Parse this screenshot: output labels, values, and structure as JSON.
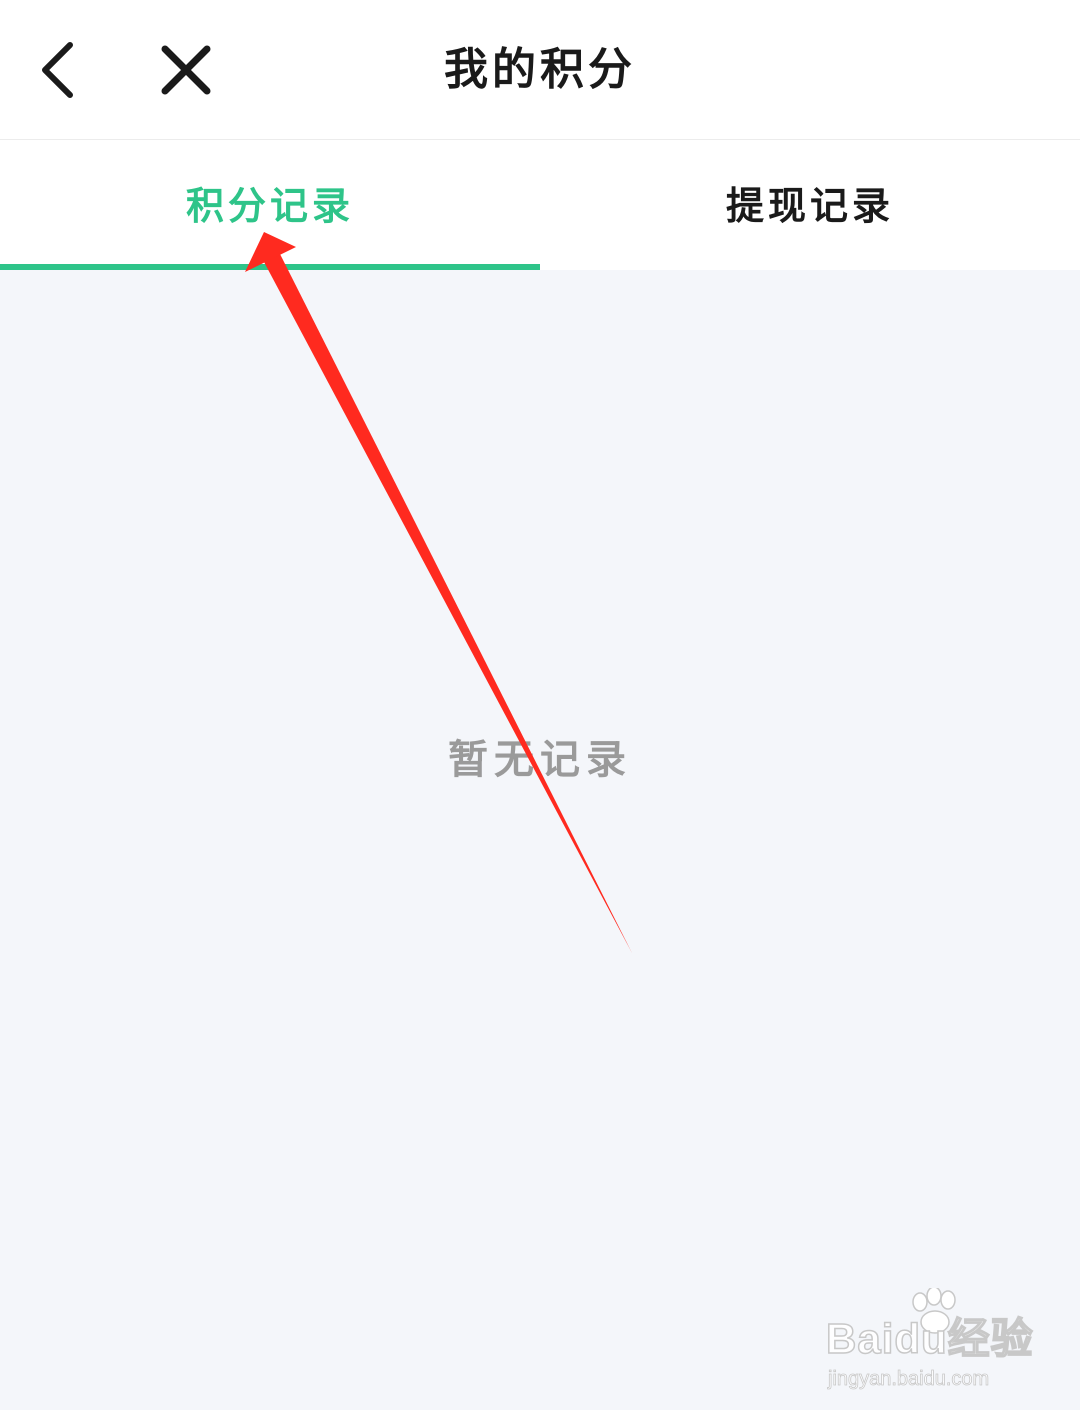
{
  "header": {
    "back_icon": "chevron-left-icon",
    "close_icon": "close-icon",
    "title": "我的积分"
  },
  "tabs": [
    {
      "label": "积分记录",
      "active": true
    },
    {
      "label": "提现记录",
      "active": false
    }
  ],
  "empty_state": {
    "text": "暂无记录"
  },
  "watermark": {
    "brand": "Baidu经验",
    "url": "jingyan.baidu.com"
  },
  "colors": {
    "accent": "#2ec489",
    "annotation_arrow": "#ff2a1f",
    "background": "#f4f6fa",
    "title_text": "#1a1a1a",
    "empty_text": "#9a9a9a"
  }
}
